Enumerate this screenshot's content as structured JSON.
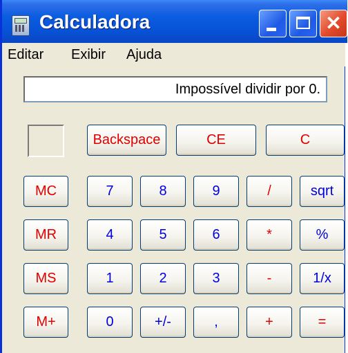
{
  "window": {
    "title": "Calculadora"
  },
  "menu": [
    "Editar",
    "Exibir",
    "Ajuda"
  ],
  "display": {
    "text": "Impossível dividir por 0."
  },
  "buttons": {
    "backspace": "Backspace",
    "ce": "CE",
    "c": "C",
    "mc": "MC",
    "mr": "MR",
    "ms": "MS",
    "mplus": "M+",
    "d7": "7",
    "d8": "8",
    "d9": "9",
    "div": "/",
    "sqrt": "sqrt",
    "d4": "4",
    "d5": "5",
    "d6": "6",
    "mul": "*",
    "pct": "%",
    "d1": "1",
    "d2": "2",
    "d3": "3",
    "sub": "-",
    "inv": "1/x",
    "d0": "0",
    "sign": "+/-",
    "dot": ",",
    "add": "+",
    "eq": "="
  },
  "colors": {
    "title_bar": "#0a5ce0",
    "red_label": "#e00000",
    "blue_label": "#0000e0",
    "window_bg": "#ece9d8"
  }
}
